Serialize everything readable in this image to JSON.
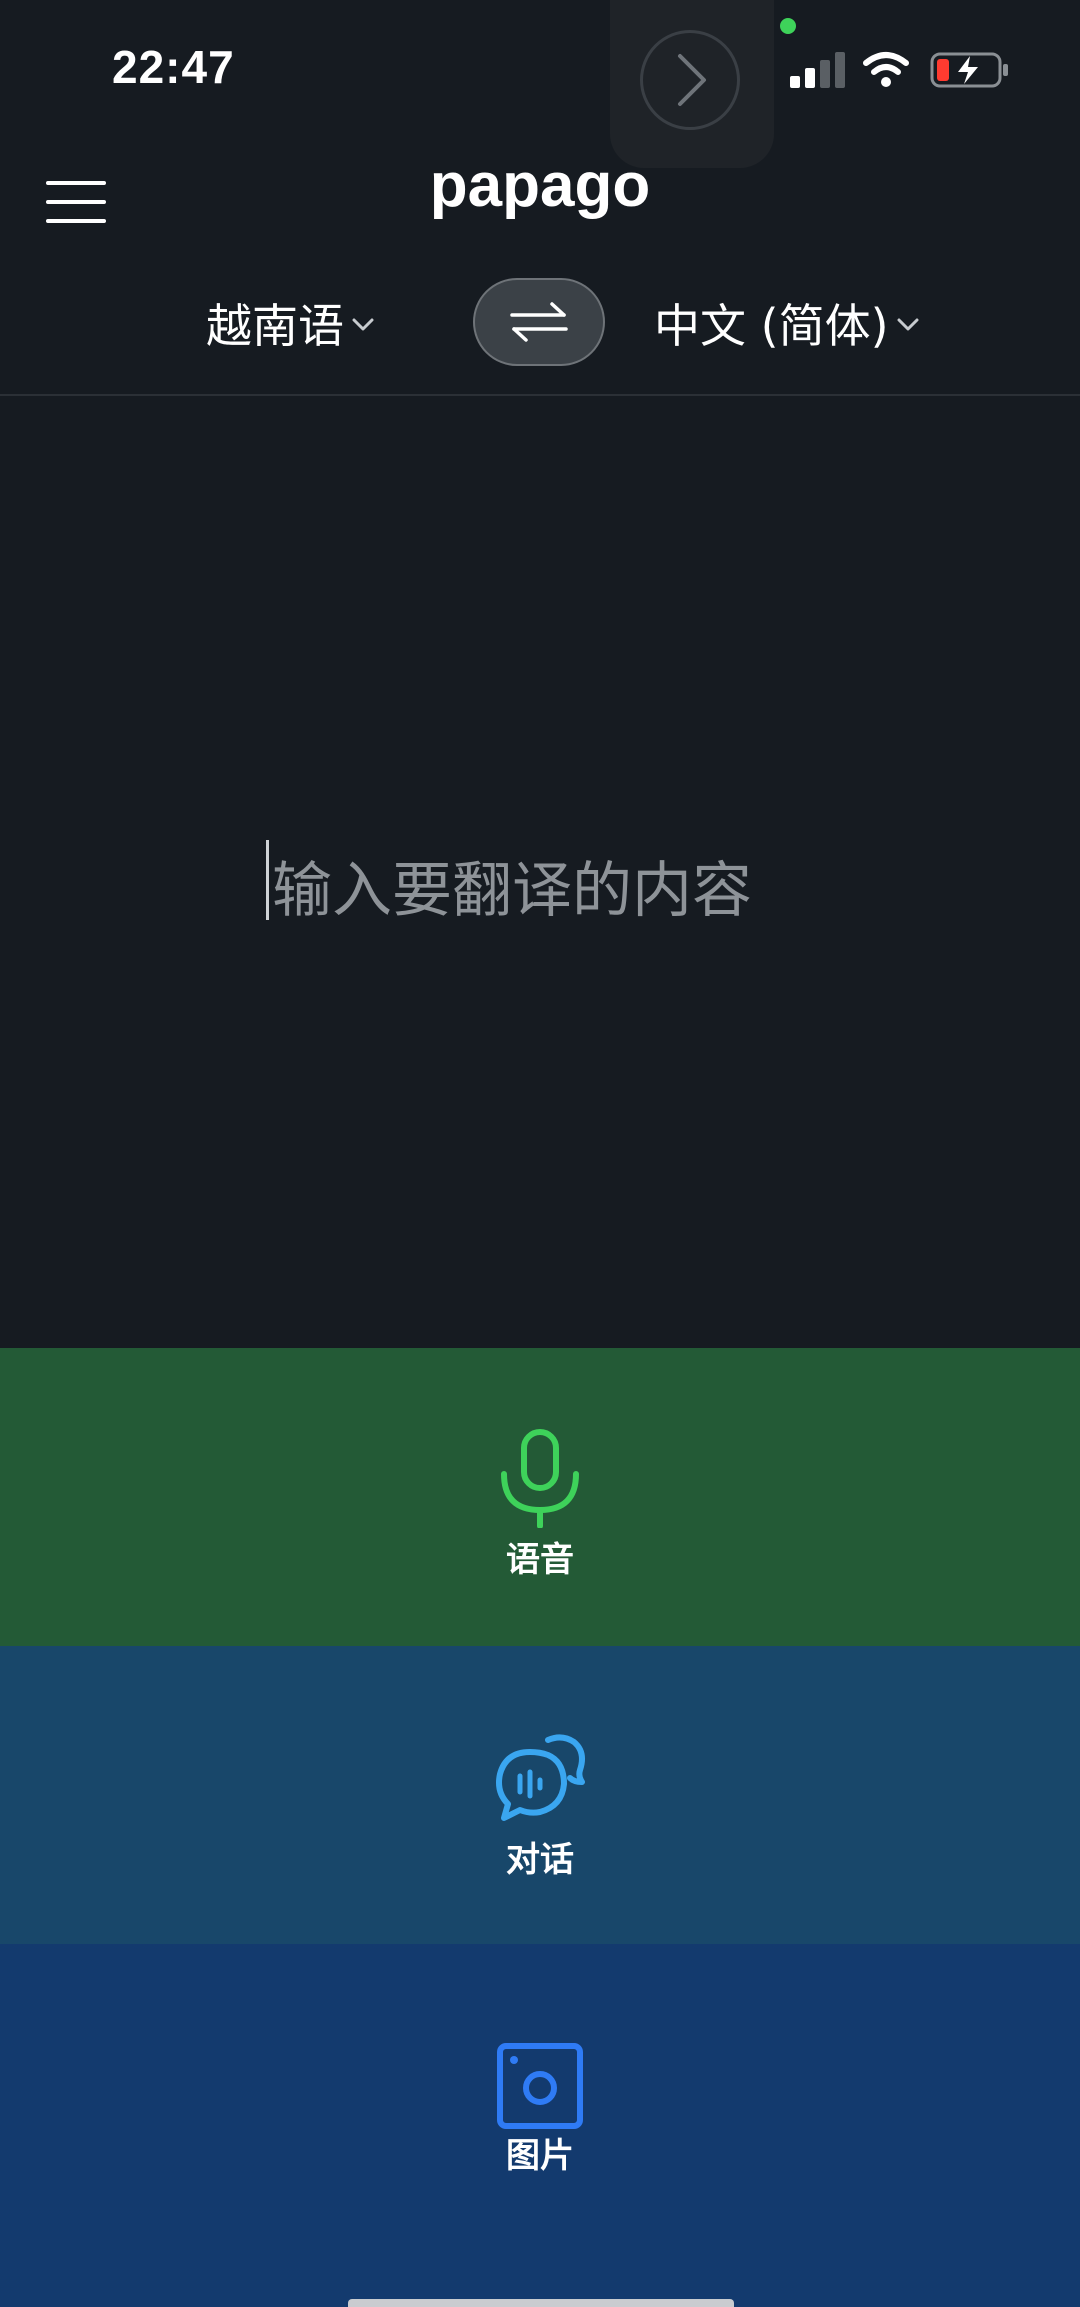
{
  "status_bar": {
    "time": "22:47"
  },
  "header": {
    "logo": "papago"
  },
  "languages": {
    "source": "越南语",
    "target": "中文 (简体)"
  },
  "input": {
    "placeholder": "输入要翻译的内容"
  },
  "modes": [
    {
      "label": "语音",
      "icon": "microphone-icon",
      "color": "#235a36",
      "accent": "#3ed25a"
    },
    {
      "label": "对话",
      "icon": "conversation-icon",
      "color": "#18476a",
      "accent": "#3aa6f0"
    },
    {
      "label": "图片",
      "icon": "image-camera-icon",
      "color": "#133a6e",
      "accent": "#2f7bf5"
    }
  ],
  "colors": {
    "background": "#161b21",
    "green_dot": "#3ed25a",
    "battery_low": "#ff3b30"
  }
}
